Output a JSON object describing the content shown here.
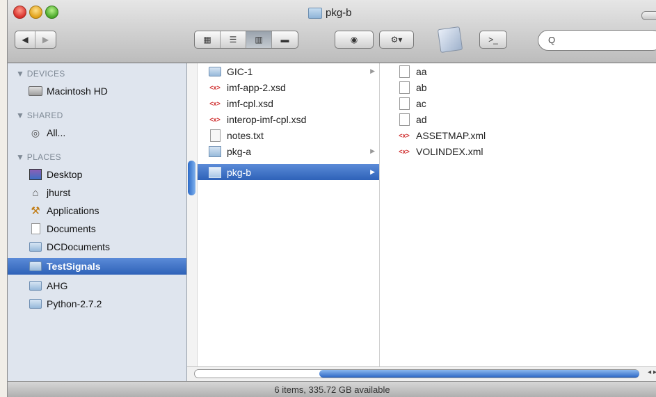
{
  "window": {
    "title": "pkg-b"
  },
  "toolbar": {
    "back_glyph": "◀",
    "forward_glyph": "▶",
    "view_icons": "▦",
    "view_list": "☰",
    "view_columns": "▥",
    "view_coverflow": "▬",
    "quicklook_glyph": "◉",
    "action_glyph": "⚙▾",
    "terminal_glyph": ">_",
    "search_glyph": "Q",
    "search_value": ""
  },
  "sidebar": {
    "devices_label": "▼ DEVICES",
    "shared_label": "▼ SHARED",
    "places_label": "▼ PLACES",
    "devices": [
      {
        "label": "Macintosh HD"
      }
    ],
    "shared": [
      {
        "label": "All..."
      }
    ],
    "places": [
      {
        "label": "Desktop"
      },
      {
        "label": "jhurst"
      },
      {
        "label": "Applications"
      },
      {
        "label": "Documents"
      },
      {
        "label": "DCDocuments"
      },
      {
        "label": "TestSignals"
      },
      {
        "label": "AHG"
      },
      {
        "label": "Python-2.7.2"
      }
    ]
  },
  "column1": {
    "items": [
      {
        "label": "GIC-1"
      },
      {
        "label": "imf-app-2.xsd"
      },
      {
        "label": "imf-cpl.xsd"
      },
      {
        "label": "interop-imf-cpl.xsd"
      },
      {
        "label": "notes.txt"
      },
      {
        "label": "pkg-a"
      },
      {
        "label": "pkg-b"
      }
    ]
  },
  "column2": {
    "items": [
      {
        "label": "aa"
      },
      {
        "label": "ab"
      },
      {
        "label": "ac"
      },
      {
        "label": "ad"
      },
      {
        "label": "ASSETMAP.xml"
      },
      {
        "label": "VOLINDEX.xml"
      }
    ]
  },
  "status": {
    "text": "6 items, 335.72 GB available"
  },
  "colors": {
    "selection": "#2e62b8",
    "sidebar_bg": "#dfe5ee"
  }
}
